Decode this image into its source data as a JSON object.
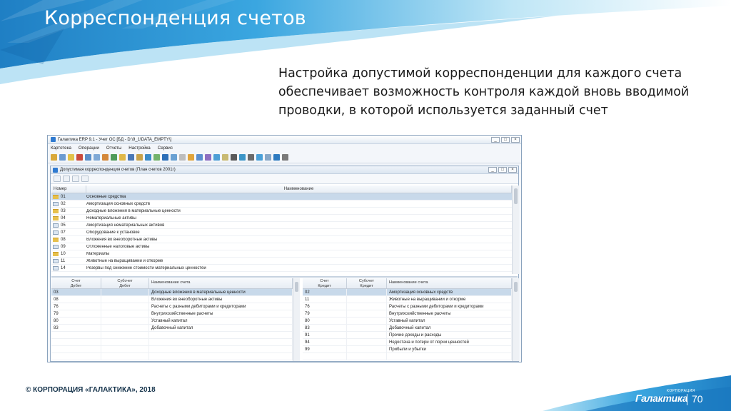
{
  "slide": {
    "title": "Корреспонденция счетов",
    "text": "Настройка допустимой корреспонденции для каждого счета обеспечивает возможность контроля каждой вновь вводимой проводки, в которой используется заданный счет",
    "copyright": "© КОРПОРАЦИЯ «ГАЛАКТИКА», 2018",
    "logo": "Галактика",
    "logo_sub": "КОРПОРАЦИЯ",
    "page_number": "70",
    "colors": {
      "accent": "#1e8fd6",
      "banner_dark": "#0f6fb8",
      "banner_light": "#8fd0ee"
    }
  },
  "app": {
    "title": "Галактика ERP 9.1 - Учет ОС [БД - D:\\9_1\\DATA_EMPTY\\]",
    "window_buttons": [
      "_",
      "□",
      "×"
    ],
    "menu": [
      "Картотека",
      "Операции",
      "Отчеты",
      "Настройка",
      "Сервис"
    ],
    "child": {
      "title": "Допустимая корреспонденция счетов (План счетов 2001г)",
      "window_buttons": [
        "_",
        "□",
        "×"
      ],
      "top_grid": {
        "headers": [
          "Номер",
          "Наименование"
        ],
        "rows": [
          {
            "icon": "folder-icon",
            "num": "01",
            "name": "Основные средства"
          },
          {
            "icon": "document-icon",
            "num": "02",
            "name": "Амортизация основных средств"
          },
          {
            "icon": "folder-icon",
            "num": "03",
            "name": "Доходные вложения в материальные ценности"
          },
          {
            "icon": "folder-icon",
            "num": "04",
            "name": "Нематериальные активы"
          },
          {
            "icon": "document-icon",
            "num": "05",
            "name": "Амортизация нематериальных активов"
          },
          {
            "icon": "document-icon",
            "num": "07",
            "name": "Оборудование к установке"
          },
          {
            "icon": "folder-icon",
            "num": "08",
            "name": "Вложения во внеоборотные активы"
          },
          {
            "icon": "document-icon",
            "num": "09",
            "name": "Отложенные налоговые активы"
          },
          {
            "icon": "folder-icon",
            "num": "10",
            "name": "Материалы"
          },
          {
            "icon": "document-icon",
            "num": "11",
            "name": "Животные на выращивании и откорме"
          },
          {
            "icon": "document-icon",
            "num": "14",
            "name": "Резервы под снижение стоимости материальных ценностей"
          }
        ]
      },
      "debit_grid": {
        "headers": [
          "Счет\nДебет",
          "Субсчет\nДебет",
          "Наименование счета"
        ],
        "rows": [
          {
            "acc": "03",
            "sub": "",
            "name": "Доходные вложения в материальные ценности"
          },
          {
            "acc": "08",
            "sub": "",
            "name": "Вложения во внеоборотные активы"
          },
          {
            "acc": "76",
            "sub": "",
            "name": "Расчеты с разными дебиторами и кредиторами"
          },
          {
            "acc": "79",
            "sub": "",
            "name": "Внутрихозяйственные расчеты"
          },
          {
            "acc": "80",
            "sub": "",
            "name": "Уставный капитал"
          },
          {
            "acc": "83",
            "sub": "",
            "name": "Добавочный капитал"
          }
        ]
      },
      "credit_grid": {
        "headers": [
          "Счет\nКредит",
          "Субсчет\nКредит",
          "Наименование счета"
        ],
        "rows": [
          {
            "acc": "02",
            "sub": "",
            "name": "Амортизация основных средств"
          },
          {
            "acc": "11",
            "sub": "",
            "name": "Животные на выращивании и откорме"
          },
          {
            "acc": "76",
            "sub": "",
            "name": "Расчеты с разными дебиторами и кредиторами"
          },
          {
            "acc": "79",
            "sub": "",
            "name": "Внутрихозяйственные расчеты"
          },
          {
            "acc": "80",
            "sub": "",
            "name": "Уставный капитал"
          },
          {
            "acc": "83",
            "sub": "",
            "name": "Добавочный капитал"
          },
          {
            "acc": "91",
            "sub": "",
            "name": "Прочие доходы и расходы"
          },
          {
            "acc": "94",
            "sub": "",
            "name": "Недостача и потери от порчи ценностей"
          },
          {
            "acc": "99",
            "sub": "",
            "name": "Прибыли и убытки"
          }
        ]
      }
    }
  }
}
